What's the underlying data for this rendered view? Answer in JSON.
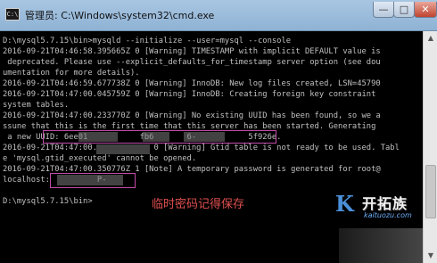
{
  "window": {
    "title": "管理员: C:\\Windows\\system32\\cmd.exe",
    "icon_label": "C:\\",
    "minimize_glyph": "—",
    "maximize_glyph": "□",
    "close_glyph": "✕"
  },
  "console": {
    "lines": [
      "D:\\mysql5.7.15\\bin>mysqld --initialize --user=mysql --console",
      "2016-09-21T04:46:58.395665Z 0 [Warning] TIMESTAMP with implicit DEFAULT value is",
      " deprecated. Please use --explicit_defaults_for_timestamp server option (see dou",
      "umentation for more details).",
      "2016-09-21T04:46:59.677738Z 0 [Warning] InnoDB: New log files created, LSN=45790",
      "2016-09-21T04:47:00.045759Z 0 [Warning] InnoDB: Creating foreign key constraint",
      "system tables.",
      "2016-09-21T04:47:00.233770Z 0 [Warning] No existing UUID has been found, so we a",
      "ssune that this is the first time that this server has been started. Generating",
      " a new UUID: 6ee01           fb6       6-           5f926e.",
      "2016-09-21T04:47:00.            0 [Warning] Gtid table is not ready to be used. Tabl",
      "e 'mysql.gtid_executed' cannot be opened.",
      "2016-09-21T04:47:00.350776Z 1 [Note] A temporary password is generated for root@",
      "localhost:          P-",
      "",
      "D:\\mysql5.7.15\\bin>"
    ]
  },
  "annotation": {
    "text": "临时密码记得保存"
  },
  "watermark": {
    "logo_glyph": "K",
    "name": "开拓族",
    "url": "kaituozu.com"
  },
  "scrollbar": {
    "up_glyph": "▲",
    "down_glyph": "▼"
  },
  "colors": {
    "console_text": "#c0c0c0",
    "console_bg": "#000000",
    "annotation": "#e05050",
    "highlight": "#c24ba8"
  }
}
